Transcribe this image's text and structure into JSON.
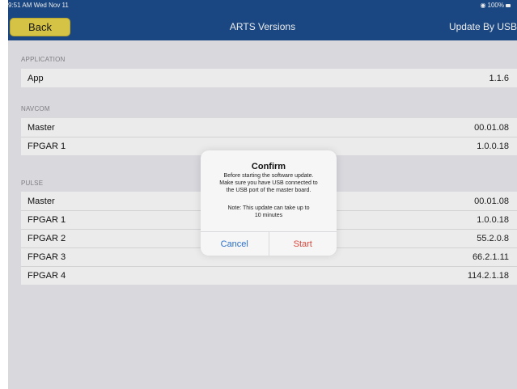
{
  "status": {
    "time": "9:51 AM Wed Nov 11",
    "battery": "100%",
    "wifi_icon": "wifi-icon",
    "battery_icon": "battery-icon"
  },
  "nav": {
    "back_label": "Back",
    "title": "ARTS Versions",
    "right_label": "Update By USB",
    "back_color": "#e8d44d",
    "bar_color": "#1d4e8e"
  },
  "sections": {
    "application": {
      "header": "APPLICATION",
      "rows": [
        {
          "label": "App",
          "value": "1.1.6"
        }
      ]
    },
    "navcom": {
      "header": "NAVCOM",
      "rows": [
        {
          "label": "Master",
          "value": "00.01.08"
        },
        {
          "label": "FPGAR 1",
          "value": "1.0.0.18"
        }
      ]
    },
    "pulse": {
      "header": "PULSE",
      "rows": [
        {
          "label": "Master",
          "value": "00.01.08"
        },
        {
          "label": "FPGAR 1",
          "value": "1.0.0.18"
        },
        {
          "label": "FPGAR 2",
          "value": "55.2.0.8"
        },
        {
          "label": "FPGAR 3",
          "value": "66.2.1.11"
        },
        {
          "label": "FPGAR 4",
          "value": "114.2.1.18"
        }
      ]
    }
  },
  "dialog": {
    "title": "Confirm",
    "message_line1": "Before starting the software update.",
    "message_line2": "Make sure you have USB connected to",
    "message_line3": "the USB port of the master board.",
    "note_line1": "Note: This update can take up to",
    "note_line2": "10 minutes",
    "cancel_label": "Cancel",
    "start_label": "Start",
    "cancel_color": "#2a6fc9",
    "start_color": "#d9453b"
  }
}
